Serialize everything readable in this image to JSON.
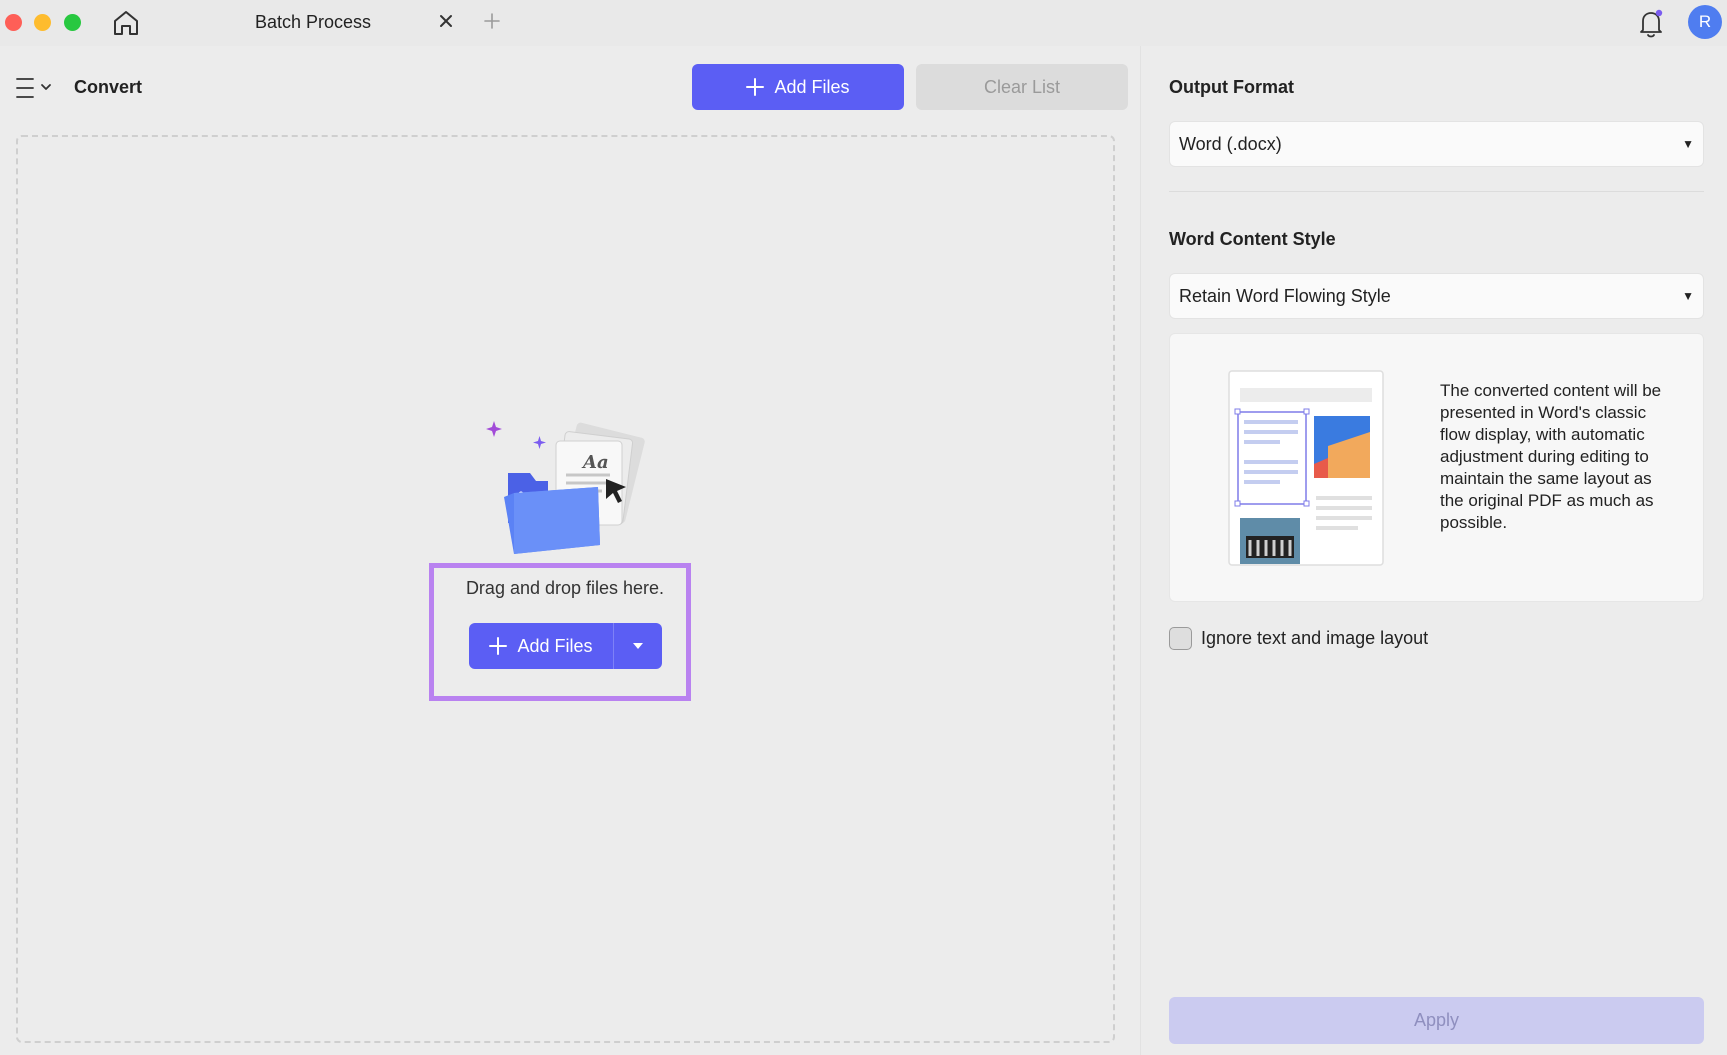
{
  "window": {
    "tab_title": "Batch Process",
    "avatar_initial": "R"
  },
  "toolbar": {
    "title": "Convert",
    "add_files_label": "Add Files",
    "clear_list_label": "Clear List"
  },
  "dropzone": {
    "hint": "Drag and drop files here.",
    "add_files_label": "Add Files"
  },
  "settings": {
    "output_format_label": "Output Format",
    "output_format_value": "Word (.docx)",
    "content_style_label": "Word Content Style",
    "content_style_value": "Retain Word Flowing Style",
    "style_description": "The converted content will be presented in Word's classic flow display, with automatic adjustment during editing to maintain the same layout as the original PDF as much as possible.",
    "ignore_layout_label": "Ignore text and image layout",
    "ignore_layout_checked": false,
    "apply_label": "Apply"
  },
  "colors": {
    "accent": "#5b5ef4",
    "highlight": "#b982f0"
  }
}
